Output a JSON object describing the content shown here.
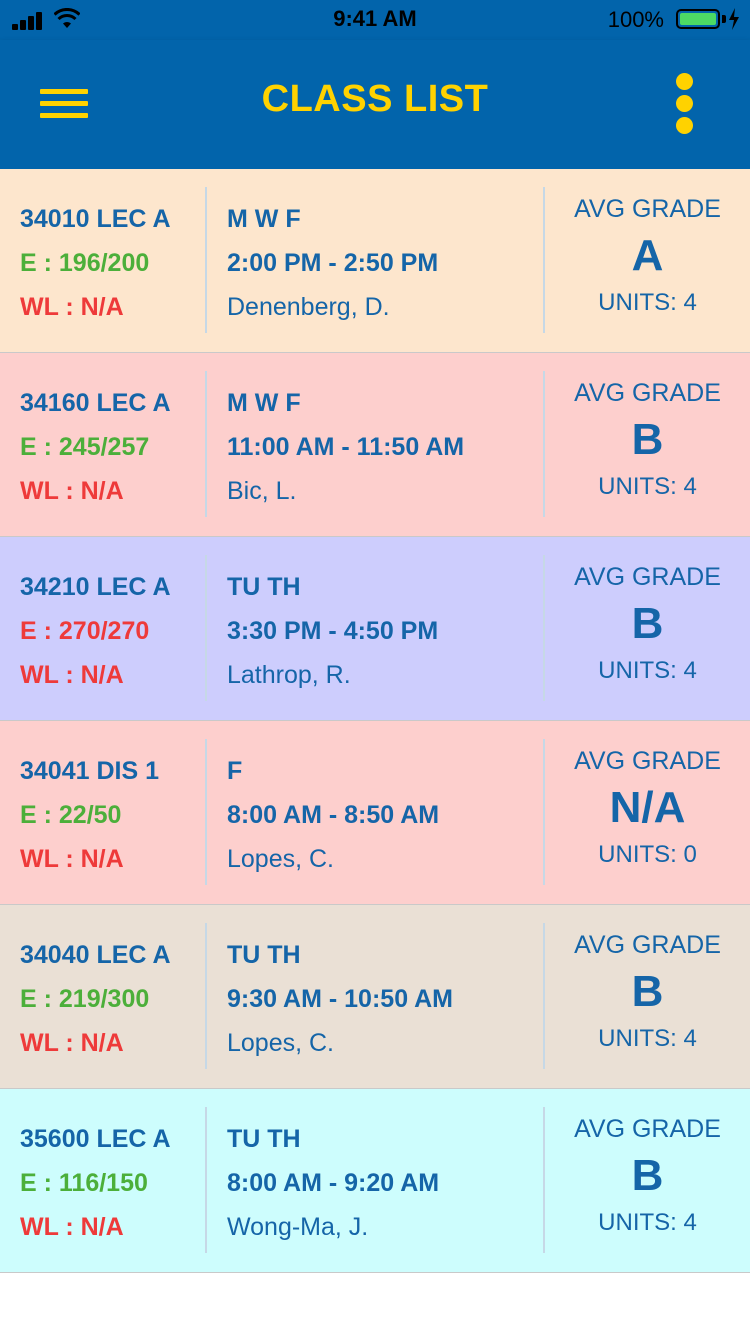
{
  "status_bar": {
    "time": "9:41 AM",
    "battery_percent": "100%",
    "battery_level": 1.0
  },
  "header": {
    "title": "CLASS LIST",
    "menu_icon": "hamburger-menu-icon",
    "more_icon": "more-vertical-icon",
    "background": "#0264ab",
    "accent": "#ffd200"
  },
  "colors": {
    "course_text": "#1565a8",
    "open_green": "#4caf3a",
    "full_red": "#ee3a3a"
  },
  "classes": [
    {
      "code": "34010 LEC A",
      "enrollment": "E : 196/200",
      "enrollment_status": "open",
      "waitlist": "WL : N/A",
      "days": "M W F",
      "time": "2:00 PM - 2:50 PM",
      "instructor": "Denenberg, D.",
      "avg_label": "AVG GRADE",
      "avg_grade": "A",
      "units": "UNITS: 4",
      "bg": "#fde6cd"
    },
    {
      "code": "34160 LEC A",
      "enrollment": "E : 245/257",
      "enrollment_status": "open",
      "waitlist": "WL : N/A",
      "days": "M W F",
      "time": "11:00 AM - 11:50 AM",
      "instructor": "Bic, L.",
      "avg_label": "AVG GRADE",
      "avg_grade": "B",
      "units": "UNITS: 4",
      "bg": "#fdcfcd"
    },
    {
      "code": "34210 LEC A",
      "enrollment": "E : 270/270",
      "enrollment_status": "full",
      "waitlist": "WL : N/A",
      "days": "TU TH",
      "time": "3:30 PM - 4:50 PM",
      "instructor": "Lathrop, R.",
      "avg_label": "AVG GRADE",
      "avg_grade": "B",
      "units": "UNITS: 4",
      "bg": "#cdcdfd"
    },
    {
      "code": "34041 DIS 1",
      "enrollment": "E : 22/50",
      "enrollment_status": "open",
      "waitlist": "WL : N/A",
      "days": "F",
      "time": "8:00 AM - 8:50 AM",
      "instructor": "Lopes, C.",
      "avg_label": "AVG GRADE",
      "avg_grade": "N/A",
      "units": "UNITS: 0",
      "bg": "#fdcfcd"
    },
    {
      "code": "34040 LEC A",
      "enrollment": "E : 219/300",
      "enrollment_status": "open",
      "waitlist": "WL : N/A",
      "days": "TU TH",
      "time": "9:30 AM - 10:50 AM",
      "instructor": "Lopes, C.",
      "avg_label": "AVG GRADE",
      "avg_grade": "B",
      "units": "UNITS: 4",
      "bg": "#eae0d5"
    },
    {
      "code": "35600 LEC A",
      "enrollment": "E : 116/150",
      "enrollment_status": "open",
      "waitlist": "WL : N/A",
      "days": "TU TH",
      "time": "8:00 AM - 9:20 AM",
      "instructor": "Wong-Ma, J.",
      "avg_label": "AVG GRADE",
      "avg_grade": "B",
      "units": "UNITS: 4",
      "bg": "#cdfdfd"
    }
  ]
}
